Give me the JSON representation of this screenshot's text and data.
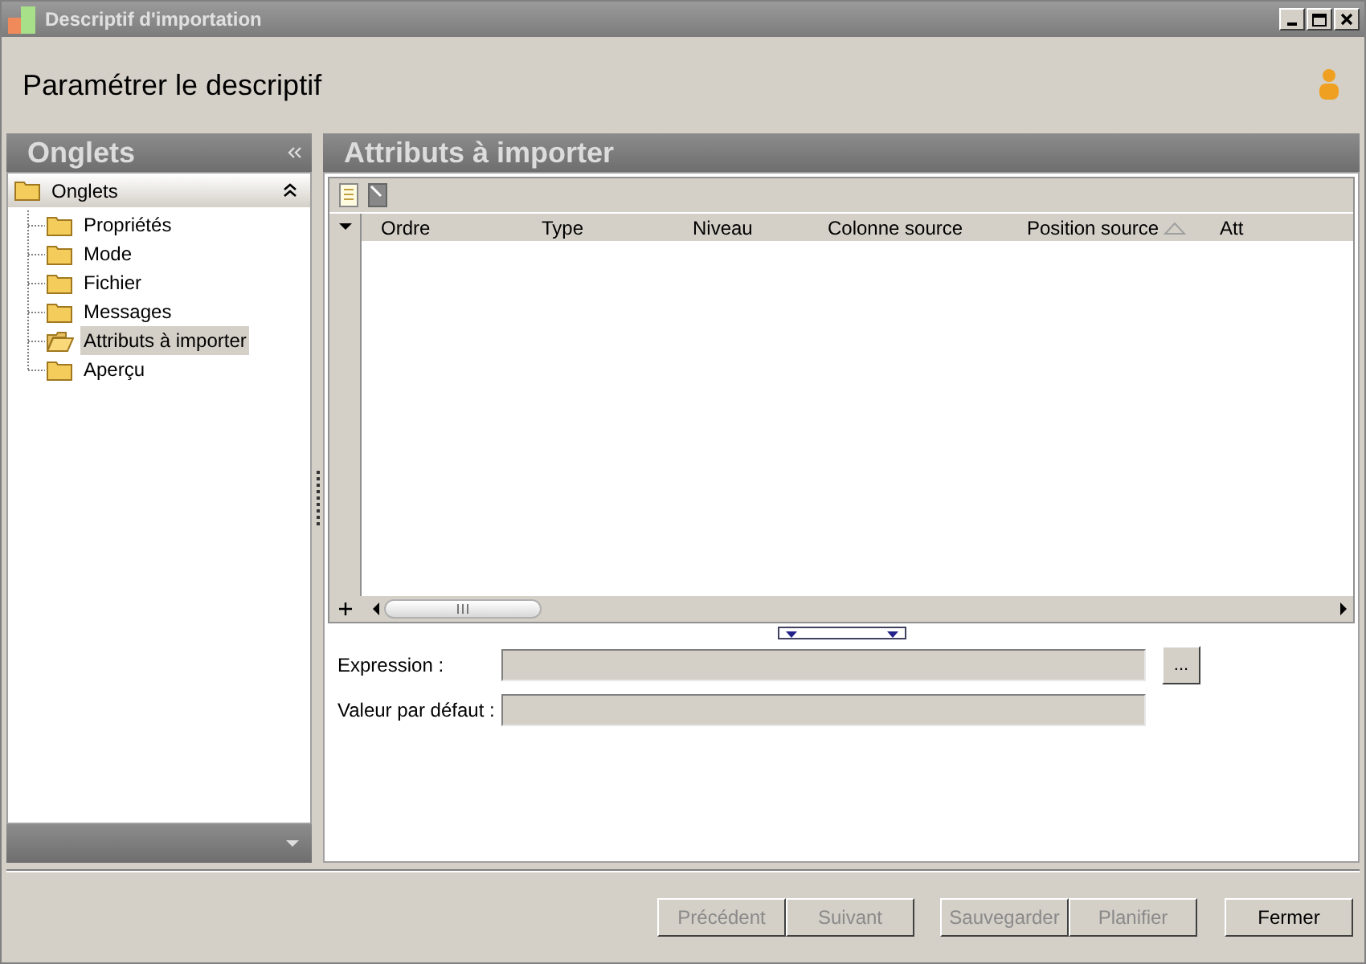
{
  "window": {
    "title": "Descriptif d'importation"
  },
  "header": {
    "title": "Paramétrer le descriptif"
  },
  "sidebar": {
    "title": "Onglets",
    "tree": [
      {
        "label": "Onglets",
        "expanded": true,
        "selected": false,
        "children": [
          {
            "label": "Propriétés",
            "selected": false
          },
          {
            "label": "Mode",
            "selected": false
          },
          {
            "label": "Fichier",
            "selected": false
          },
          {
            "label": "Messages",
            "selected": false
          },
          {
            "label": "Attributs à importer",
            "selected": true
          },
          {
            "label": "Aperçu",
            "selected": false
          }
        ]
      }
    ]
  },
  "panel": {
    "title": "Attributs à importer",
    "table": {
      "columns": [
        {
          "label": "Ordre",
          "sorted": false
        },
        {
          "label": "Type",
          "sorted": false
        },
        {
          "label": "Niveau",
          "sorted": false
        },
        {
          "label": "Colonne source",
          "sorted": false
        },
        {
          "label": "Position source",
          "sorted": true
        },
        {
          "label": "Att",
          "sorted": false
        }
      ]
    },
    "fields": [
      {
        "label": "Expression :",
        "browse": "..."
      },
      {
        "label": "Valeur par défaut :"
      }
    ]
  },
  "buttons": [
    {
      "label": "Précédent",
      "disabled": true
    },
    {
      "label": "Suivant",
      "disabled": true
    },
    {
      "label": "Sauvegarder",
      "disabled": true
    },
    {
      "label": "Planifier",
      "disabled": true
    },
    {
      "label": "Fermer",
      "disabled": false
    }
  ]
}
